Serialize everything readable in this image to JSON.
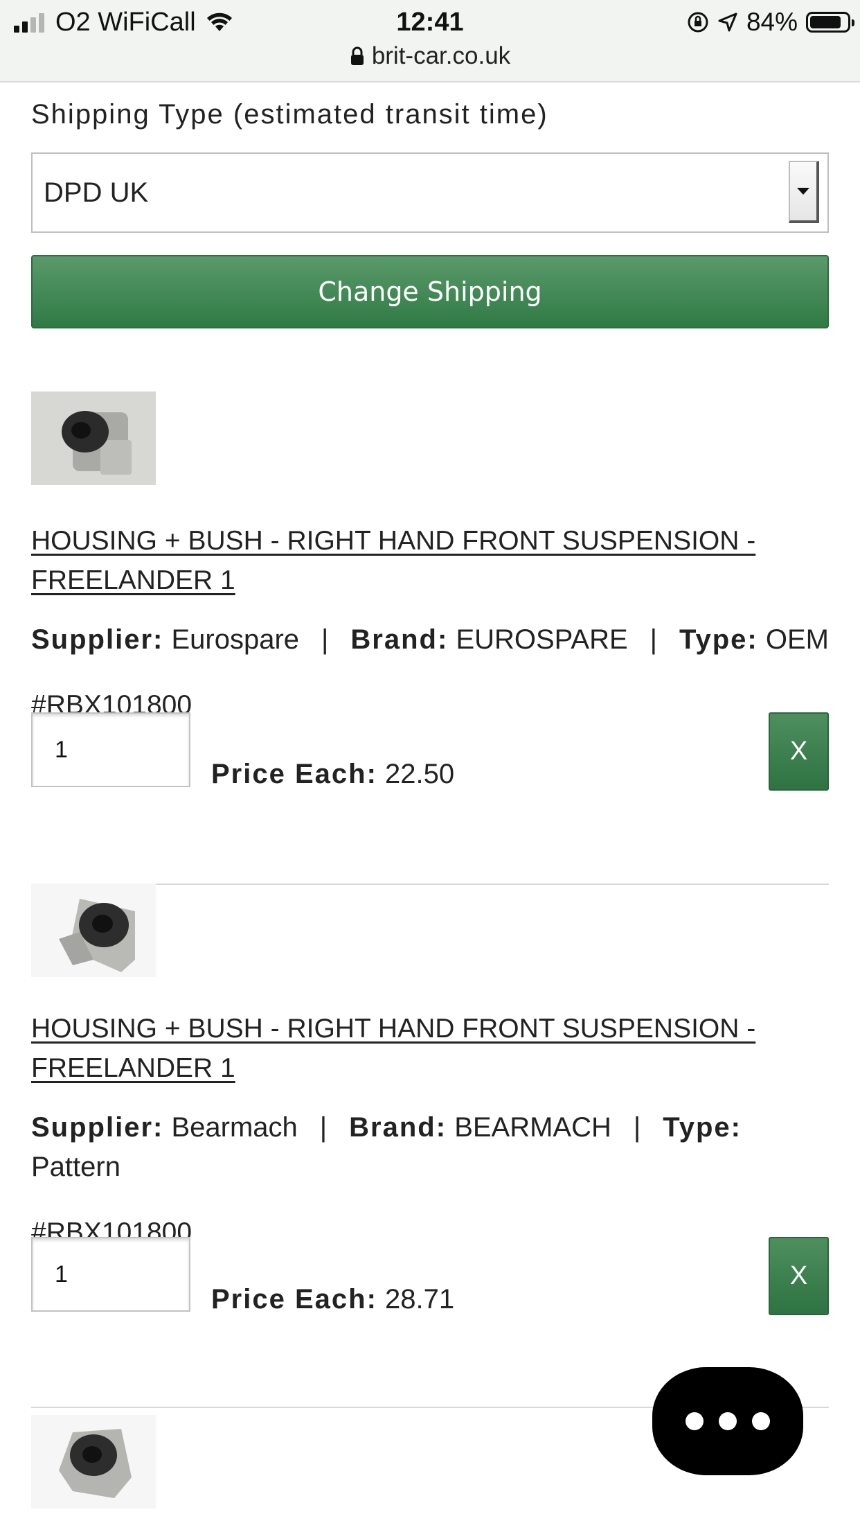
{
  "status_bar": {
    "carrier": "O2 WiFiCall",
    "time": "12:41",
    "battery_percent": "84%",
    "battery_level": 0.84,
    "url": "brit-car.co.uk"
  },
  "shipping": {
    "label": "Shipping Type (estimated transit time)",
    "selected": "DPD UK",
    "change_button": "Change Shipping"
  },
  "items": [
    {
      "title_line1": "HOUSING + BUSH - RIGHT HAND FRONT SUSPENSION -",
      "title_line2": "FREELANDER 1",
      "supplier_label": "Supplier:",
      "supplier": "Eurospare",
      "brand_label": "Brand:",
      "brand": "EUROSPARE",
      "type_label": "Type:",
      "type": "OEM",
      "sku": "#RBX101800",
      "qty": "1",
      "price_label": "Price Each:",
      "price": "22.50",
      "remove_label": "X"
    },
    {
      "title_line1": "HOUSING + BUSH - RIGHT HAND FRONT SUSPENSION -",
      "title_line2": "FREELANDER 1",
      "supplier_label": "Supplier:",
      "supplier": "Bearmach",
      "brand_label": "Brand:",
      "brand": "BEARMACH",
      "type_label": "Type:",
      "type": "Pattern",
      "sku": "#RBX101800",
      "qty": "1",
      "price_label": "Price Each:",
      "price": "28.71",
      "remove_label": "X"
    }
  ],
  "separator": "|",
  "colors": {
    "accent_green": "#3a8450",
    "status_bar_bg": "#f2f4f1",
    "chat_fab": "#000000"
  },
  "icons": [
    "signal-icon",
    "wifi-icon",
    "orientation-lock-icon",
    "location-arrow-icon",
    "battery-icon",
    "lock-icon",
    "dropdown-arrow-icon",
    "chat-ellipsis-icon"
  ]
}
